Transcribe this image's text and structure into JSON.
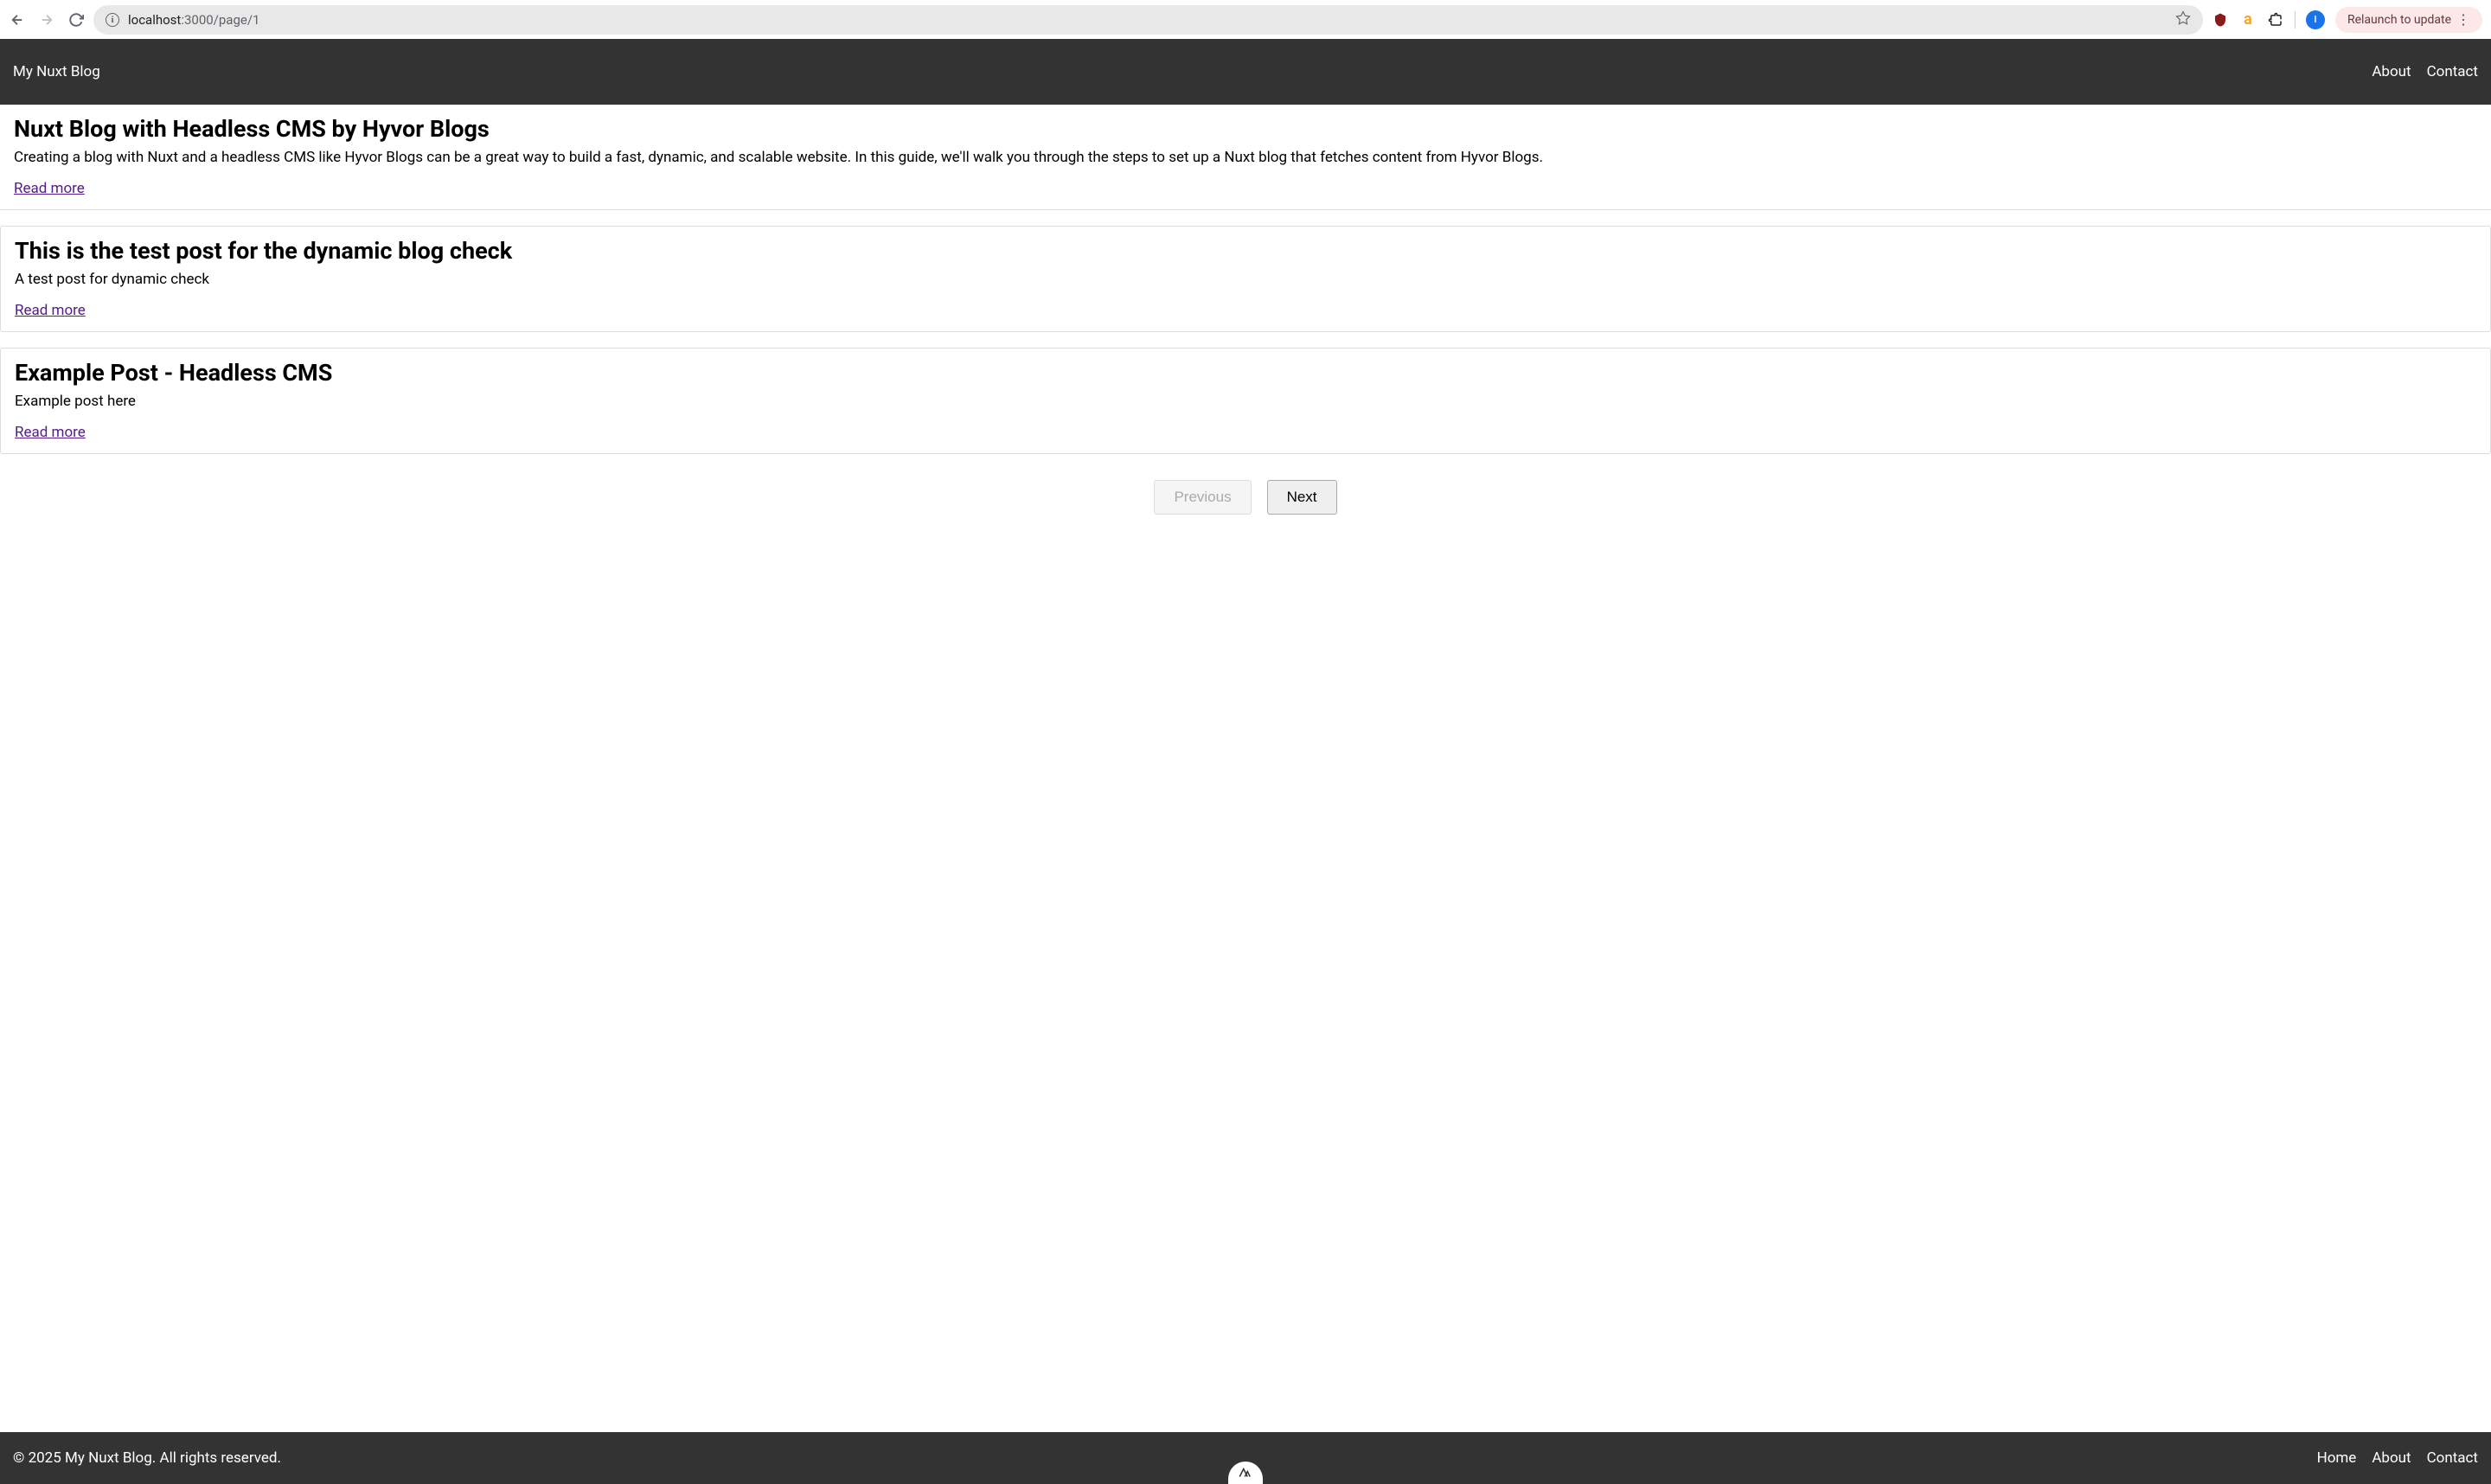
{
  "browser": {
    "url_host": "localhost",
    "url_port_path": ":3000/page/1",
    "relaunch_label": "Relaunch to update",
    "profile_initial": "I"
  },
  "header": {
    "site_title": "My Nuxt Blog",
    "nav": {
      "about": "About",
      "contact": "Contact"
    }
  },
  "posts": [
    {
      "title": "Nuxt Blog with Headless CMS by Hyvor Blogs",
      "excerpt": "Creating a blog with Nuxt and a headless CMS like Hyvor Blogs can be a great way to build a fast, dynamic, and scalable website. In this guide, we'll walk you through the steps to set up a Nuxt blog that fetches content from Hyvor Blogs.",
      "read_more": "Read more"
    },
    {
      "title": "This is the test post for the dynamic blog check",
      "excerpt": "A test post for dynamic check",
      "read_more": "Read more"
    },
    {
      "title": "Example Post - Headless CMS",
      "excerpt": "Example post here",
      "read_more": "Read more"
    }
  ],
  "pagination": {
    "previous": "Previous",
    "next": "Next"
  },
  "footer": {
    "copyright": "© 2025 My Nuxt Blog. All rights reserved.",
    "nav": {
      "home": "Home",
      "about": "About",
      "contact": "Contact"
    }
  }
}
